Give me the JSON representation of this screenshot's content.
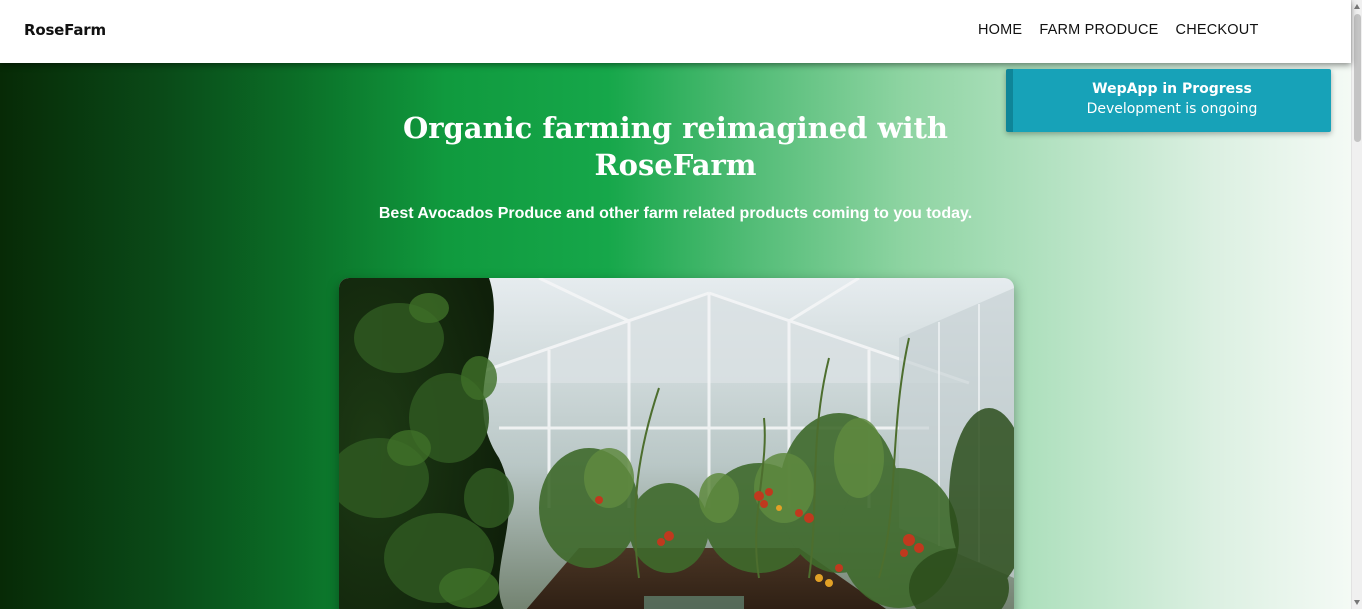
{
  "navbar": {
    "brand": "RoseFarm",
    "links": [
      {
        "label": "HOME"
      },
      {
        "label": "FARM PRODUCE"
      },
      {
        "label": "CHECKOUT"
      }
    ]
  },
  "hero": {
    "title_line1": "Organic farming reimagined with",
    "title_line2": "RoseFarm",
    "subtitle": "Best Avocados Produce and other farm related products coming to you today.",
    "gradient_colors": [
      "#072a06",
      "#16a74a",
      "#8ed4a2",
      "#f4faf5"
    ]
  },
  "toast": {
    "title": "WepApp in Progress",
    "message": "Development is ongoing",
    "color": "#17a2b8"
  }
}
